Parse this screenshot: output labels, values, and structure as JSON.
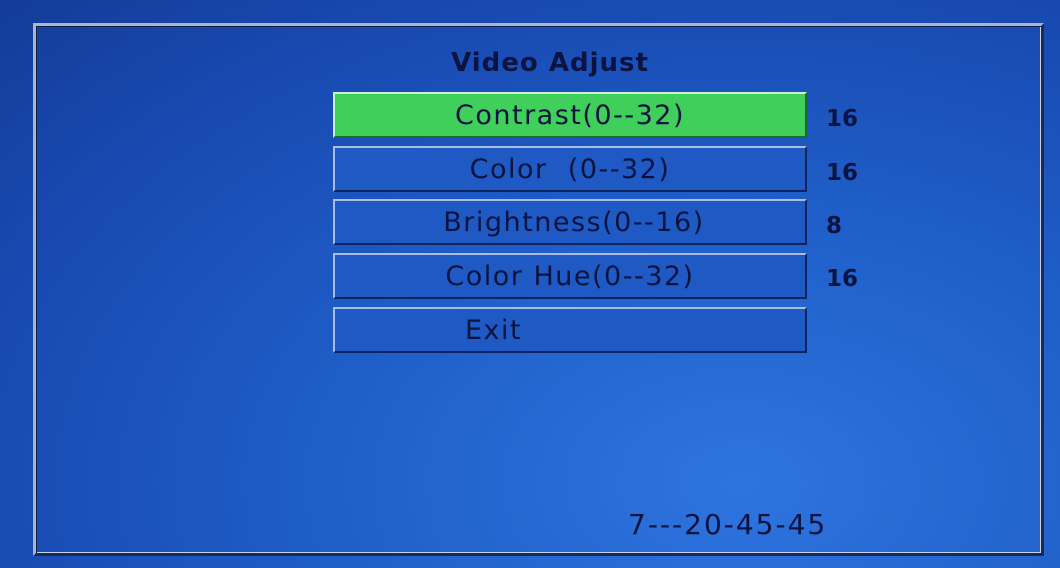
{
  "menu": {
    "title": "Video Adjust",
    "items": [
      {
        "label": "Contrast(0--32)",
        "value": "16",
        "selected": true
      },
      {
        "label": "Color  (0--32)",
        "value": "16",
        "selected": false
      },
      {
        "label": "Brightness(0--16)",
        "value": "8",
        "selected": false
      },
      {
        "label": "Color Hue(0--32)",
        "value": "16",
        "selected": false
      },
      {
        "label": "Exit",
        "value": "",
        "selected": false
      }
    ]
  },
  "footer": {
    "code": "7---20-45-45"
  },
  "colors": {
    "background": "#1f59c4",
    "selected": "#3fcf5a",
    "text": "#0b1440"
  }
}
